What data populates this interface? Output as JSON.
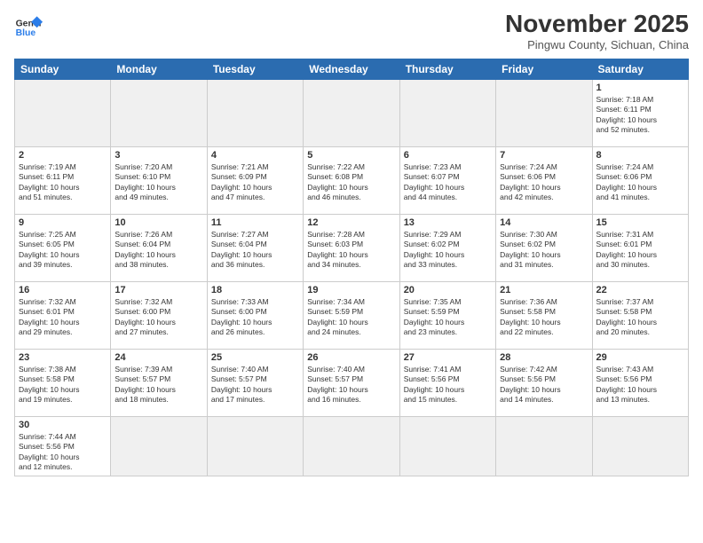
{
  "header": {
    "logo_general": "General",
    "logo_blue": "Blue",
    "month_title": "November 2025",
    "subtitle": "Pingwu County, Sichuan, China"
  },
  "weekdays": [
    "Sunday",
    "Monday",
    "Tuesday",
    "Wednesday",
    "Thursday",
    "Friday",
    "Saturday"
  ],
  "weeks": [
    [
      {
        "day": "",
        "info": ""
      },
      {
        "day": "",
        "info": ""
      },
      {
        "day": "",
        "info": ""
      },
      {
        "day": "",
        "info": ""
      },
      {
        "day": "",
        "info": ""
      },
      {
        "day": "",
        "info": ""
      },
      {
        "day": "1",
        "info": "Sunrise: 7:18 AM\nSunset: 6:11 PM\nDaylight: 10 hours\nand 52 minutes."
      }
    ],
    [
      {
        "day": "2",
        "info": "Sunrise: 7:19 AM\nSunset: 6:11 PM\nDaylight: 10 hours\nand 51 minutes."
      },
      {
        "day": "3",
        "info": "Sunrise: 7:20 AM\nSunset: 6:10 PM\nDaylight: 10 hours\nand 49 minutes."
      },
      {
        "day": "4",
        "info": "Sunrise: 7:21 AM\nSunset: 6:09 PM\nDaylight: 10 hours\nand 47 minutes."
      },
      {
        "day": "5",
        "info": "Sunrise: 7:22 AM\nSunset: 6:08 PM\nDaylight: 10 hours\nand 46 minutes."
      },
      {
        "day": "6",
        "info": "Sunrise: 7:23 AM\nSunset: 6:07 PM\nDaylight: 10 hours\nand 44 minutes."
      },
      {
        "day": "7",
        "info": "Sunrise: 7:24 AM\nSunset: 6:06 PM\nDaylight: 10 hours\nand 42 minutes."
      },
      {
        "day": "8",
        "info": "Sunrise: 7:24 AM\nSunset: 6:06 PM\nDaylight: 10 hours\nand 41 minutes."
      }
    ],
    [
      {
        "day": "9",
        "info": "Sunrise: 7:25 AM\nSunset: 6:05 PM\nDaylight: 10 hours\nand 39 minutes."
      },
      {
        "day": "10",
        "info": "Sunrise: 7:26 AM\nSunset: 6:04 PM\nDaylight: 10 hours\nand 38 minutes."
      },
      {
        "day": "11",
        "info": "Sunrise: 7:27 AM\nSunset: 6:04 PM\nDaylight: 10 hours\nand 36 minutes."
      },
      {
        "day": "12",
        "info": "Sunrise: 7:28 AM\nSunset: 6:03 PM\nDaylight: 10 hours\nand 34 minutes."
      },
      {
        "day": "13",
        "info": "Sunrise: 7:29 AM\nSunset: 6:02 PM\nDaylight: 10 hours\nand 33 minutes."
      },
      {
        "day": "14",
        "info": "Sunrise: 7:30 AM\nSunset: 6:02 PM\nDaylight: 10 hours\nand 31 minutes."
      },
      {
        "day": "15",
        "info": "Sunrise: 7:31 AM\nSunset: 6:01 PM\nDaylight: 10 hours\nand 30 minutes."
      }
    ],
    [
      {
        "day": "16",
        "info": "Sunrise: 7:32 AM\nSunset: 6:01 PM\nDaylight: 10 hours\nand 29 minutes."
      },
      {
        "day": "17",
        "info": "Sunrise: 7:32 AM\nSunset: 6:00 PM\nDaylight: 10 hours\nand 27 minutes."
      },
      {
        "day": "18",
        "info": "Sunrise: 7:33 AM\nSunset: 6:00 PM\nDaylight: 10 hours\nand 26 minutes."
      },
      {
        "day": "19",
        "info": "Sunrise: 7:34 AM\nSunset: 5:59 PM\nDaylight: 10 hours\nand 24 minutes."
      },
      {
        "day": "20",
        "info": "Sunrise: 7:35 AM\nSunset: 5:59 PM\nDaylight: 10 hours\nand 23 minutes."
      },
      {
        "day": "21",
        "info": "Sunrise: 7:36 AM\nSunset: 5:58 PM\nDaylight: 10 hours\nand 22 minutes."
      },
      {
        "day": "22",
        "info": "Sunrise: 7:37 AM\nSunset: 5:58 PM\nDaylight: 10 hours\nand 20 minutes."
      }
    ],
    [
      {
        "day": "23",
        "info": "Sunrise: 7:38 AM\nSunset: 5:58 PM\nDaylight: 10 hours\nand 19 minutes."
      },
      {
        "day": "24",
        "info": "Sunrise: 7:39 AM\nSunset: 5:57 PM\nDaylight: 10 hours\nand 18 minutes."
      },
      {
        "day": "25",
        "info": "Sunrise: 7:40 AM\nSunset: 5:57 PM\nDaylight: 10 hours\nand 17 minutes."
      },
      {
        "day": "26",
        "info": "Sunrise: 7:40 AM\nSunset: 5:57 PM\nDaylight: 10 hours\nand 16 minutes."
      },
      {
        "day": "27",
        "info": "Sunrise: 7:41 AM\nSunset: 5:56 PM\nDaylight: 10 hours\nand 15 minutes."
      },
      {
        "day": "28",
        "info": "Sunrise: 7:42 AM\nSunset: 5:56 PM\nDaylight: 10 hours\nand 14 minutes."
      },
      {
        "day": "29",
        "info": "Sunrise: 7:43 AM\nSunset: 5:56 PM\nDaylight: 10 hours\nand 13 minutes."
      }
    ],
    [
      {
        "day": "30",
        "info": "Sunrise: 7:44 AM\nSunset: 5:56 PM\nDaylight: 10 hours\nand 12 minutes."
      },
      {
        "day": "",
        "info": ""
      },
      {
        "day": "",
        "info": ""
      },
      {
        "day": "",
        "info": ""
      },
      {
        "day": "",
        "info": ""
      },
      {
        "day": "",
        "info": ""
      },
      {
        "day": "",
        "info": ""
      }
    ]
  ]
}
